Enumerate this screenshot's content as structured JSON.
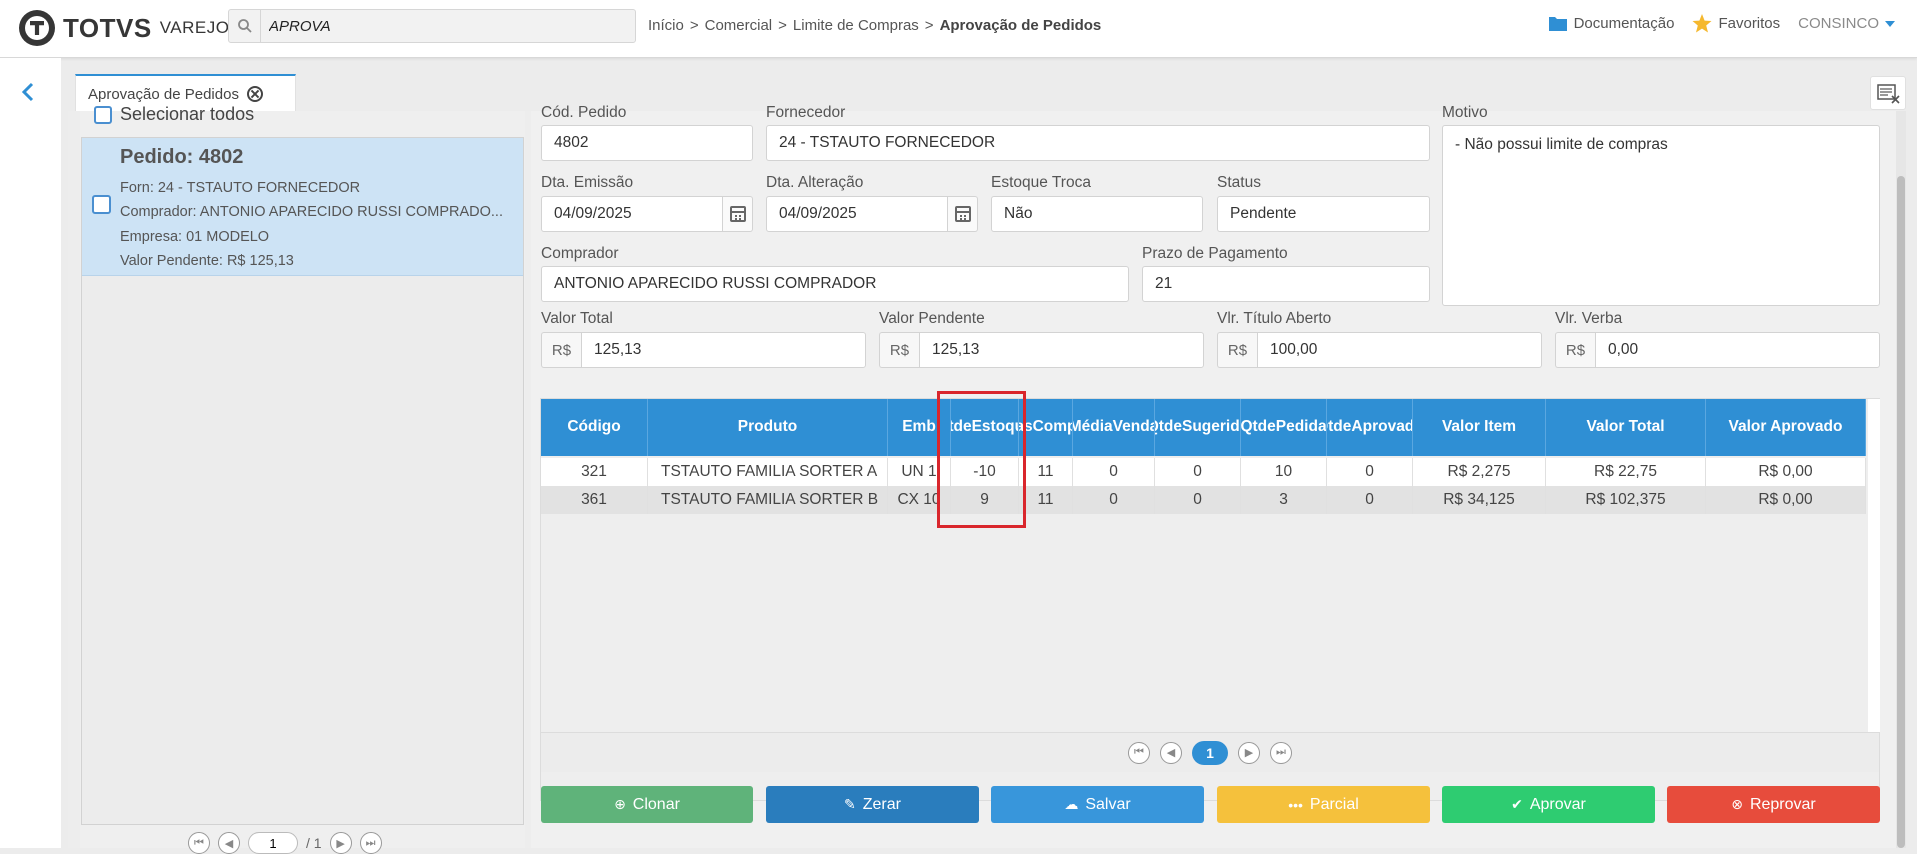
{
  "header": {
    "logo_text": "TOTVS",
    "logo_sub": "VAREJO",
    "search_value": "APROVA",
    "breadcrumb": [
      "Início",
      "Comercial",
      "Limite de Compras"
    ],
    "breadcrumb_current": "Aprovação de Pedidos",
    "breadcrumb_sep": ">",
    "doc_label": "Documentação",
    "fav_label": "Favoritos",
    "user_label": "CONSINCO"
  },
  "tab": {
    "label": "Aprovação de Pedidos"
  },
  "list": {
    "select_all": "Selecionar todos",
    "order": {
      "title": "Pedido: 4802",
      "forn": "Forn: 24 - TSTAUTO FORNECEDOR",
      "comprador": "Comprador: ANTONIO APARECIDO RUSSI COMPRADO...",
      "empresa": "Empresa: 01 MODELO",
      "valor": "Valor Pendente: R$ 125,13"
    },
    "pager": {
      "page": "1",
      "total": "/ 1"
    }
  },
  "form": {
    "cod_pedido": {
      "label": "Cód. Pedido",
      "value": "4802"
    },
    "fornecedor": {
      "label": "Fornecedor",
      "value": "24 - TSTAUTO FORNECEDOR"
    },
    "motivo": {
      "label": "Motivo",
      "value": "- Não possui limite de compras"
    },
    "dta_emissao": {
      "label": "Dta. Emissão",
      "value": "04/09/2025"
    },
    "dta_alteracao": {
      "label": "Dta. Alteração",
      "value": "04/09/2025"
    },
    "estoque_troca": {
      "label": "Estoque Troca",
      "value": "Não"
    },
    "status": {
      "label": "Status",
      "value": "Pendente"
    },
    "comprador": {
      "label": "Comprador",
      "value": "ANTONIO APARECIDO RUSSI COMPRADOR"
    },
    "prazo": {
      "label": "Prazo de Pagamento",
      "value": "21"
    },
    "currency": "R$",
    "valor_total": {
      "label": "Valor Total",
      "value": "125,13"
    },
    "valor_pendente": {
      "label": "Valor Pendente",
      "value": "125,13"
    },
    "vlr_titulo": {
      "label": "Vlr. Título Aberto",
      "value": "100,00"
    },
    "vlr_verba": {
      "label": "Vlr. Verba",
      "value": "0,00"
    }
  },
  "table": {
    "headers": [
      [
        "Código"
      ],
      [
        "Produto"
      ],
      [
        "Emb"
      ],
      [
        "Qtde",
        "Estoque"
      ],
      [
        "Dias",
        "Compra"
      ],
      [
        "Média",
        "Venda"
      ],
      [
        "Qtde",
        "Sugerida"
      ],
      [
        "Qtde",
        "Pedida"
      ],
      [
        "Qtde",
        "Aprovada"
      ],
      [
        "Valor Item"
      ],
      [
        "Valor Total"
      ],
      [
        "Valor Aprovado"
      ]
    ],
    "rows": [
      [
        "321",
        "TSTAUTO FAMILIA SORTER A",
        "UN 1",
        "-10",
        "11",
        "0",
        "0",
        "10",
        "0",
        "R$ 2,275",
        "R$ 22,75",
        "R$ 0,00"
      ],
      [
        "361",
        "TSTAUTO FAMILIA SORTER B",
        "CX 10",
        "9",
        "11",
        "0",
        "0",
        "3",
        "0",
        "R$ 34,125",
        "R$ 102,375",
        "R$ 0,00"
      ]
    ],
    "page": "1"
  },
  "buttons": {
    "clonar": "Clonar",
    "zerar": "Zerar",
    "salvar": "Salvar",
    "parcial": "Parcial",
    "aprovar": "Aprovar",
    "reprovar": "Reprovar"
  },
  "colors": {
    "accent": "#2f8fd4",
    "clonar": "#5fb37a",
    "zerar": "#2a7dbd",
    "salvar": "#3896db",
    "parcial": "#f5c13c",
    "aprovar": "#2ecc71",
    "reprovar": "#e74c3c",
    "highlight": "#d9262c"
  }
}
